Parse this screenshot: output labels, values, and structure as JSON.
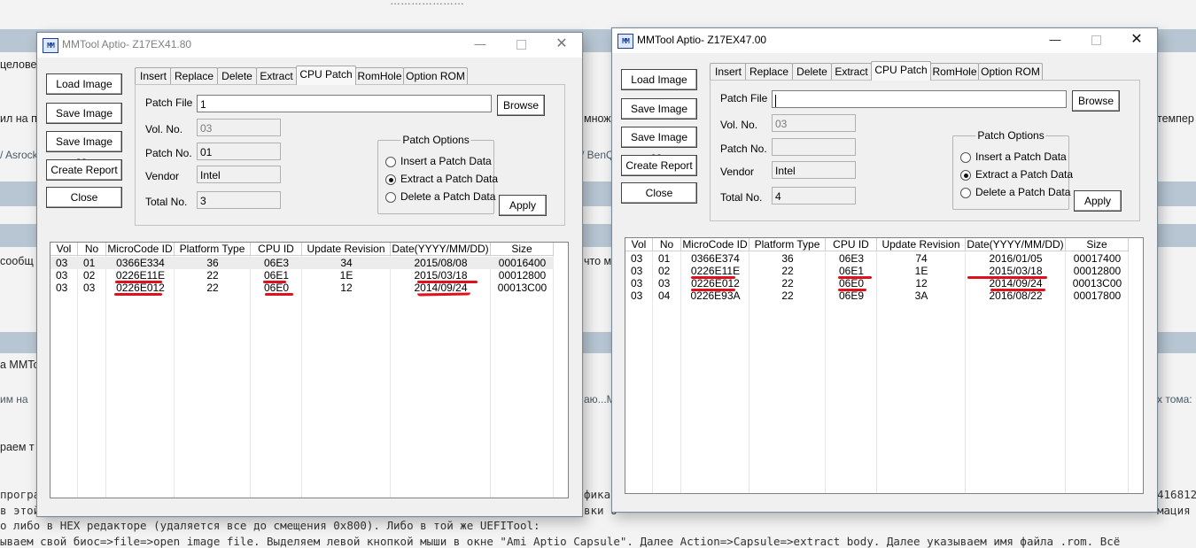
{
  "background": {
    "top_snippet": "…………………",
    "left_fragments": [
      "целове",
      "ил на п",
      "/ Asrock",
      "сообщ",
      "а MMTo",
      "им на",
      "раем т",
      "програ",
      "в этой",
      "о либо в HEX редакторе (удаляется все до смещения 0x800). Либо в той же UEFITool:",
      "ываем свой биос=>file=>open image file. Выделяем левой кнопкой мыши в окне \"Ami Aptio Capsule\". Далее Action=>Capsule=>extract body. Далее указываем имя файла .rom. Всё"
    ],
    "middle_fragments": [
      "множ",
      "/ BenQ",
      "что м",
      "аю...М",
      "фика",
      "вки о"
    ],
    "right_fragments": [
      "темпер",
      "х тома:",
      "416812",
      "мация"
    ]
  },
  "windows": [
    {
      "id": "w1",
      "title": "MMTool Aptio- Z17EX41.80",
      "icon": "mmtool-app-icon",
      "caption": {
        "minimize": "—",
        "maximize": "□",
        "close": "✕"
      },
      "side_buttons": [
        "Load Image",
        "Save Image",
        "Save Image as..",
        "Create Report",
        "Close"
      ],
      "tabs": [
        "Insert",
        "Replace",
        "Delete",
        "Extract",
        "CPU Patch",
        "RomHole",
        "Option ROM"
      ],
      "active_tab": "CPU Patch",
      "form": {
        "patch_file_label": "Patch File",
        "patch_file_value": "1",
        "browse_label": "Browse",
        "vol_no_label": "Vol. No.",
        "vol_no_value": "03",
        "patch_no_label": "Patch No.",
        "patch_no_value": "01",
        "vendor_label": "Vendor",
        "vendor_value": "Intel",
        "total_no_label": "Total No.",
        "total_no_value": "3",
        "patch_options_title": "Patch Options",
        "options": [
          "Insert a Patch Data",
          "Extract a Patch Data",
          "Delete a Patch Data"
        ],
        "selected_option": "Extract a Patch Data",
        "apply_label": "Apply"
      },
      "table": {
        "headers": [
          "Vol",
          "No",
          "MicroCode ID",
          "Platform Type",
          "CPU ID",
          "Update Revision",
          "Date(YYYY/MM/DD)",
          "Size"
        ],
        "rows": [
          [
            "03",
            "01",
            "0366E334",
            "36",
            "06E3",
            "34",
            "2015/08/08",
            "00016400"
          ],
          [
            "03",
            "02",
            "0226E11E",
            "22",
            "06E1",
            "1E",
            "2015/03/18",
            "00012800"
          ],
          [
            "03",
            "03",
            "0226E012",
            "22",
            "06E0",
            "12",
            "2014/09/24",
            "00013C00"
          ]
        ],
        "selected_row": 0
      }
    },
    {
      "id": "w2",
      "title": "MMTool Aptio- Z17EX47.00",
      "icon": "mmtool-app-icon",
      "caption": {
        "minimize": "—",
        "maximize": "□",
        "close": "✕"
      },
      "side_buttons": [
        "Load Image",
        "Save Image",
        "Save Image as..",
        "Create Report",
        "Close"
      ],
      "tabs": [
        "Insert",
        "Replace",
        "Delete",
        "Extract",
        "CPU Patch",
        "RomHole",
        "Option ROM"
      ],
      "active_tab": "CPU Patch",
      "form": {
        "patch_file_label": "Patch File",
        "patch_file_value": "",
        "browse_label": "Browse",
        "vol_no_label": "Vol. No.",
        "vol_no_value": "03",
        "patch_no_label": "Patch No.",
        "patch_no_value": "",
        "vendor_label": "Vendor",
        "vendor_value": "Intel",
        "total_no_label": "Total No.",
        "total_no_value": "4",
        "patch_options_title": "Patch Options",
        "options": [
          "Insert a Patch Data",
          "Extract a Patch Data",
          "Delete a Patch Data"
        ],
        "selected_option": "Extract a Patch Data",
        "apply_label": "Apply"
      },
      "table": {
        "headers": [
          "Vol",
          "No",
          "MicroCode ID",
          "Platform Type",
          "CPU ID",
          "Update Revision",
          "Date(YYYY/MM/DD)",
          "Size"
        ],
        "rows": [
          [
            "03",
            "01",
            "0366E374",
            "36",
            "06E3",
            "74",
            "2016/01/05",
            "00017400"
          ],
          [
            "03",
            "02",
            "0226E11E",
            "22",
            "06E1",
            "1E",
            "2015/03/18",
            "00012800"
          ],
          [
            "03",
            "03",
            "0226E012",
            "22",
            "06E0",
            "12",
            "2014/09/24",
            "00013C00"
          ],
          [
            "03",
            "04",
            "0226E93A",
            "22",
            "06E9",
            "3A",
            "2016/08/22",
            "00017800"
          ]
        ],
        "selected_row": -1
      }
    }
  ],
  "colors": {
    "annotation": "#e0101c",
    "band": "#b7c6d2"
  }
}
